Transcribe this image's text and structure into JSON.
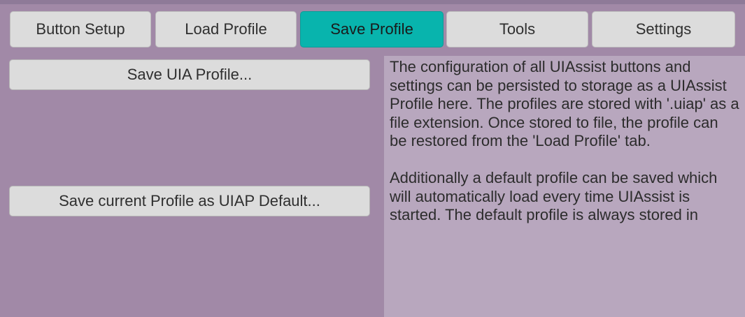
{
  "tabs": [
    {
      "label": "Button Setup",
      "active": false
    },
    {
      "label": "Load Profile",
      "active": false
    },
    {
      "label": "Save Profile",
      "active": true
    },
    {
      "label": "Tools",
      "active": false
    },
    {
      "label": "Settings",
      "active": false
    }
  ],
  "actions": {
    "save_uia_profile": "Save UIA Profile...",
    "save_default": "Save current Profile as UIAP Default..."
  },
  "info": {
    "paragraph1": "The configuration of all UIAssist buttons and settings can be persisted to storage as a UIAssist Profile here. The profiles are stored with '.uiap' as a file extension. Once stored to file, the profile can be restored from the 'Load Profile' tab.",
    "paragraph2": "Additionally a default profile can be saved which will automatically load every time UIAssist is started. The default profile is always stored in"
  },
  "colors": {
    "background": "#a189a7",
    "tab_active": "#08b4ad",
    "button": "#dcdcdc",
    "info_panel": "#b8a7be"
  }
}
